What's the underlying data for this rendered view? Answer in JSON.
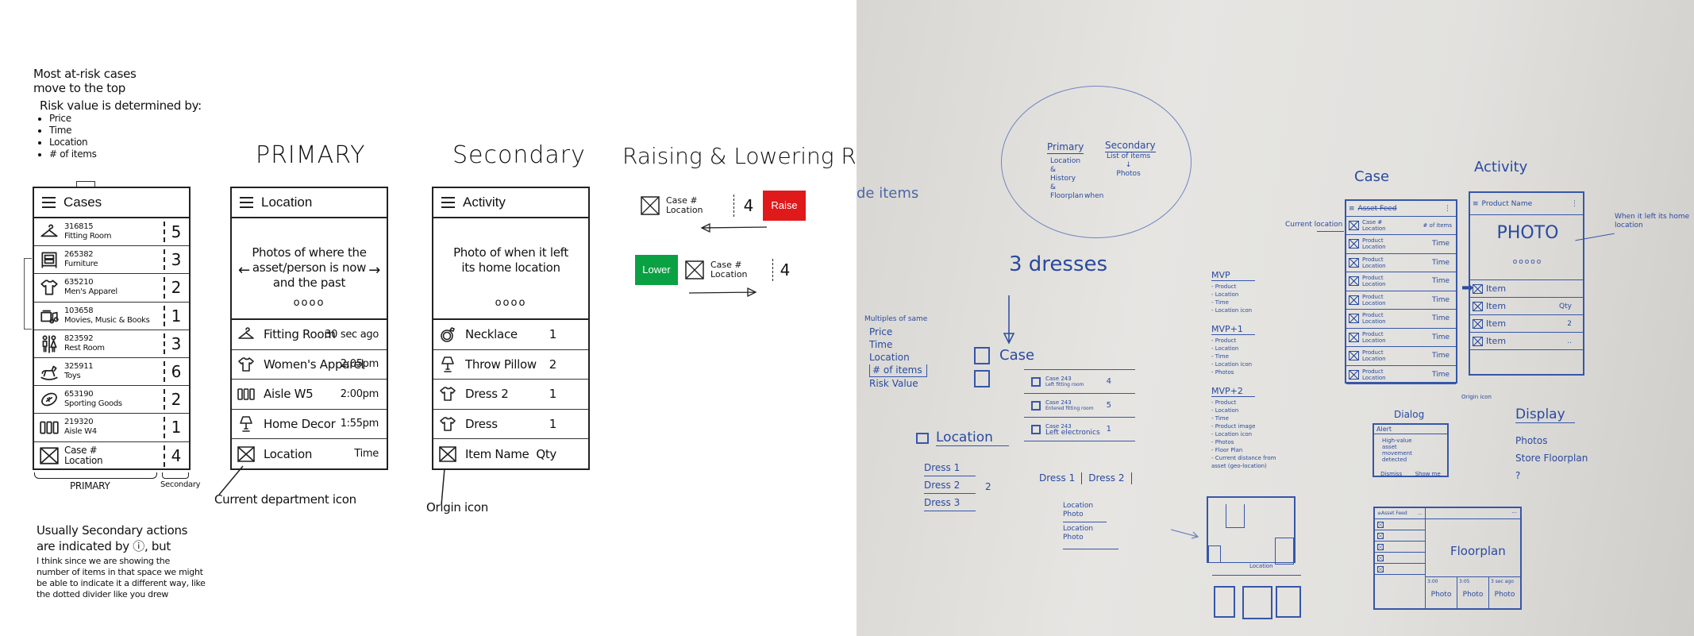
{
  "sketch": {
    "notes_top": {
      "line1": "Most at-risk cases",
      "line2": "move to the top",
      "risk_heading": "Risk value is determined by:",
      "risk_factors": [
        "Price",
        "Time",
        "Location",
        "# of items"
      ]
    },
    "cases_panel": {
      "title": "Cases",
      "rows": [
        {
          "icon": "hanger-icon",
          "id": "316815",
          "dept": "Fitting Room",
          "count": "5"
        },
        {
          "icon": "dresser-icon",
          "id": "265382",
          "dept": "Furniture",
          "count": "3"
        },
        {
          "icon": "shirt-icon",
          "id": "635210",
          "dept": "Men's Apparel",
          "count": "2"
        },
        {
          "icon": "media-icon",
          "id": "103658",
          "dept": "Movies, Music & Books",
          "count": "1"
        },
        {
          "icon": "restroom-icon",
          "id": "823592",
          "dept": "Rest Room",
          "count": "3"
        },
        {
          "icon": "rocking-horse-icon",
          "id": "325911",
          "dept": "Toys",
          "count": "6"
        },
        {
          "icon": "football-icon",
          "id": "653190",
          "dept": "Sporting Goods",
          "count": "2"
        },
        {
          "icon": "aisle-icon",
          "id": "219320",
          "dept": "Aisle W4",
          "count": "1"
        },
        {
          "icon": "placeholder-image-icon",
          "id": "Case #",
          "dept": "Location",
          "count": "4"
        }
      ],
      "primary_label": "PRIMARY",
      "secondary_label": "Secondary"
    },
    "location_panel": {
      "section_title": "PRIMARY",
      "title": "Location",
      "photo_text": "Photos of where the asset/person is now and the past",
      "carousel_dots": "oooo",
      "rows": [
        {
          "icon": "hanger-icon",
          "name": "Fitting Room",
          "time": "30 sec ago"
        },
        {
          "icon": "shirt-icon",
          "name": "Women's Apparel",
          "time": "2:05pm"
        },
        {
          "icon": "aisle-icon",
          "name": "Aisle W5",
          "time": "2:00pm"
        },
        {
          "icon": "lamp-icon",
          "name": "Home Decor",
          "time": "1:55pm"
        },
        {
          "icon": "placeholder-image-icon",
          "name": "Location",
          "time": "Time"
        }
      ],
      "annotation": "Current department icon"
    },
    "activity_panel": {
      "section_title": "Secondary",
      "title": "Activity",
      "photo_text": "Photo of when it left its home location",
      "carousel_dots": "oooo",
      "rows": [
        {
          "icon": "ring-icon",
          "name": "Necklace",
          "qty": "1"
        },
        {
          "icon": "lamp-icon",
          "name": "Throw Pillow",
          "qty": "2"
        },
        {
          "icon": "shirt-icon",
          "name": "Dress 2",
          "qty": "1"
        },
        {
          "icon": "shirt-icon",
          "name": "Dress",
          "qty": "1"
        },
        {
          "icon": "placeholder-image-icon",
          "name": "Item Name",
          "qty": "Qty"
        }
      ],
      "annotation": "Origin icon"
    },
    "risk": {
      "title": "Raising & Lowering Risk",
      "raise": {
        "case": "Case #",
        "location": "Location",
        "count": "4",
        "button": "Raise",
        "color": "#e0191b"
      },
      "lower": {
        "case": "Case #",
        "location": "Location",
        "count": "4",
        "button": "Lower",
        "color": "#0aa142"
      }
    },
    "notes_bottom": {
      "line1": "Usually Secondary actions",
      "line2": "are indicated by ⓘ, but",
      "line3": "I think since we are showing the",
      "line4": "number of items in that space we might",
      "line5": "be able to indicate it a different way, like",
      "line6": "the dotted divider like you drew"
    }
  },
  "whiteboard": {
    "ink_color": "#2a4a9e",
    "partial_left": "de items",
    "circle": {
      "primary": "Primary",
      "primary_items": [
        "Location",
        "&",
        "History",
        "&",
        "Floorplan"
      ],
      "when": "when",
      "secondary": "Secondary",
      "secondary_items": [
        "List of items",
        "↓",
        "Photos"
      ]
    },
    "three_dresses": "3 dresses",
    "case_label": "Case",
    "case_list": [
      {
        "title": "Case 243",
        "sub": "Left fitting room",
        "n": "4"
      },
      {
        "title": "Case 243",
        "sub": "Entered fitting room",
        "n": "5"
      },
      {
        "title": "Case 243",
        "sub": "Left electronics",
        "n": "1"
      }
    ],
    "multiples": [
      "Multiples of same",
      "Price",
      "Time",
      "Location",
      "# of items",
      "Risk Value"
    ],
    "location_label": "Location",
    "dress_list": [
      "Dress 1",
      "Dress 2",
      "Dress 3"
    ],
    "dress_2_count": "2",
    "dress_tabs": [
      "Dress 1",
      "Dress 2"
    ],
    "mvp": [
      {
        "title": "MVP",
        "items": [
          "Product",
          "Location",
          "Time",
          "Location icon"
        ]
      },
      {
        "title": "MVP+1",
        "items": [
          "Product",
          "Location",
          "Time",
          "Location icon",
          "Photos"
        ]
      },
      {
        "title": "MVP+2",
        "items": [
          "Product",
          "Location",
          "Time",
          "Product image",
          "Location icon",
          "Photos",
          "Floor Plan",
          "Current distance from asset (geo-location)"
        ]
      }
    ],
    "case_sketch": {
      "title": "Case",
      "header": "Asset Feed",
      "first_row": {
        "line1": "Case #",
        "line2": "Location",
        "right": "# of items"
      },
      "row_template": {
        "line1": "Product",
        "line2": "Location",
        "right": "Time"
      },
      "row_count": 8,
      "annotation": "Current location"
    },
    "activity_sketch": {
      "title": "Activity",
      "header": "Product Name",
      "photo": "PHOTO",
      "dots": "ooooo",
      "items": [
        {
          "name": "Item",
          "qty": ""
        },
        {
          "name": "Item",
          "qty": "Qty"
        },
        {
          "name": "Item",
          "qty": "2"
        },
        {
          "name": "Item",
          "qty": ".."
        }
      ],
      "annotation": "When it left its home location",
      "origin_annotation": "Origin icon"
    },
    "dialog": {
      "label": "Dialog",
      "title": "Alert",
      "message": "High-value asset movement detected",
      "dismiss": "Dismiss",
      "show_me": "Show me"
    },
    "display": {
      "title": "Display",
      "items": [
        "Photos",
        "Store Floorplan",
        "?"
      ]
    },
    "location_photo_list": [
      "Location",
      "Photo",
      "Location",
      "Photo"
    ],
    "floorplan_location": "Location",
    "tablet": {
      "header": "Asset Feed",
      "menu": "...",
      "main": "Floorplan",
      "photos": [
        {
          "time": "3:00",
          "label": "Photo"
        },
        {
          "time": "3:05",
          "label": "Photo"
        },
        {
          "time": "3 sec ago",
          "label": "Photo"
        }
      ]
    }
  }
}
